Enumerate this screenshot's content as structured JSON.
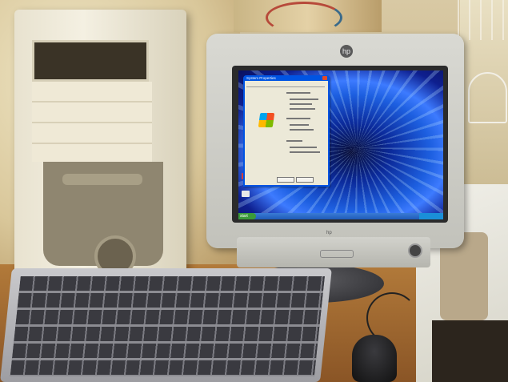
{
  "scene": {
    "objects": [
      "tower",
      "monitor",
      "keyboard",
      "mouse",
      "desk",
      "chair"
    ]
  },
  "monitor": {
    "logo_text": "hp",
    "brand_text": "hp",
    "screen": {
      "dialog_title": "System Properties",
      "start_label": "start"
    }
  },
  "colors": {
    "desktop_blue": "#1d5fe0",
    "taskbar": "#1f5bb8",
    "desk": "#b27a3a"
  }
}
